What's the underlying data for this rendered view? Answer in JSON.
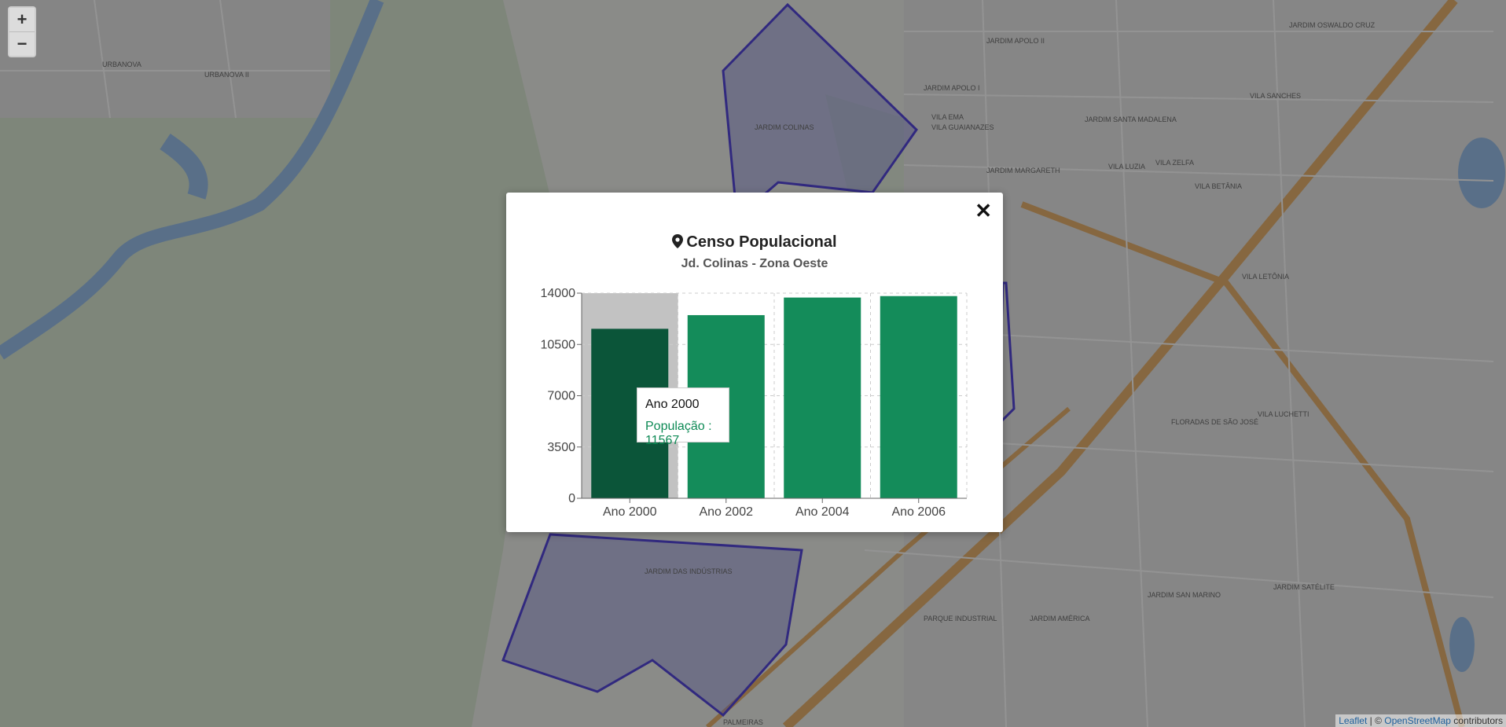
{
  "map": {
    "zoom_in": "+",
    "zoom_out": "−",
    "attribution": {
      "leaflet": "Leaflet",
      "separator": " | © ",
      "osm": "OpenStreetMap",
      "suffix": " contributors"
    },
    "labels": [
      "JARDIM APOLO I",
      "JARDIM APOLO II",
      "VILA EMA",
      "VILA GUAIANAZES",
      "JARDIM SANTA MADALENA",
      "VILA LUZIA",
      "JARDIM MARGARETH",
      "VILA ZELFA",
      "VILA BETÂNIA",
      "JARDIM COLINAS",
      "URBANOVA II",
      "URBANOVA",
      "FLORADAS DE SÃO JOSÉ",
      "VILA LUCHETTI",
      "PARQUE INDUSTRIAL",
      "JARDIM SAN MARINO",
      "JARDIM AMÉRICA",
      "JARDIM SATÉLITE",
      "JARDIM DAS INDÚSTRIAS",
      "PALMEIRAS",
      "JARDIM OSWALDO CRUZ",
      "VILA SANCHES",
      "VILA LETÔNIA"
    ]
  },
  "popup": {
    "close_icon": "✕",
    "icon": "map-marker-icon",
    "title": "Censo Populacional",
    "subtitle": "Jd. Colinas - Zona Oeste",
    "tooltip": {
      "label": "Ano 2000",
      "value_text": "População : 11567"
    }
  },
  "chart_data": {
    "type": "bar",
    "categories": [
      "Ano 2000",
      "Ano 2002",
      "Ano 2004",
      "Ano 2006"
    ],
    "series": [
      {
        "values": [
          11567,
          12500,
          13700,
          13800
        ]
      }
    ],
    "ylim": [
      0,
      14000
    ],
    "yticks": [
      0,
      3500,
      7000,
      10500,
      14000
    ],
    "grid": true,
    "highlighted_index": 0,
    "colors": {
      "bar": "#148c5a",
      "bar_active": "#0b5539",
      "cursor": "#c2c2c2",
      "grid": "#cccccc"
    }
  }
}
